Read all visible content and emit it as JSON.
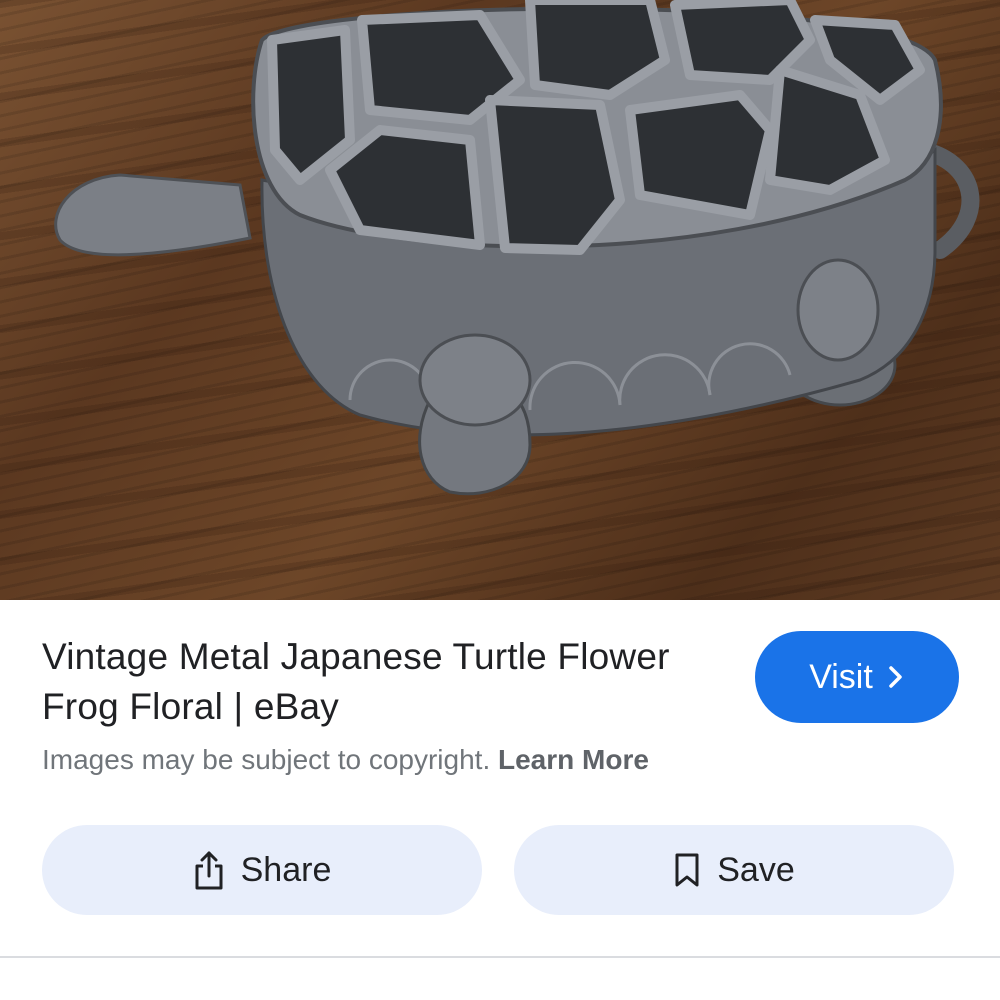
{
  "result": {
    "title": "Vintage Metal Japanese Turtle Flower Frog Floral | eBay",
    "visit_label": "Visit",
    "copyright_notice": "Images may be subject to copyright.",
    "learn_more_label": "Learn More"
  },
  "actions": {
    "share_label": "Share",
    "save_label": "Save"
  },
  "icons": {
    "visit": "chevron-right-icon",
    "share": "share-icon",
    "save": "bookmark-icon"
  },
  "colors": {
    "primary": "#1a73e8",
    "action_bg": "#e8eefb",
    "title_text": "#202124",
    "muted_text": "#70757a"
  }
}
